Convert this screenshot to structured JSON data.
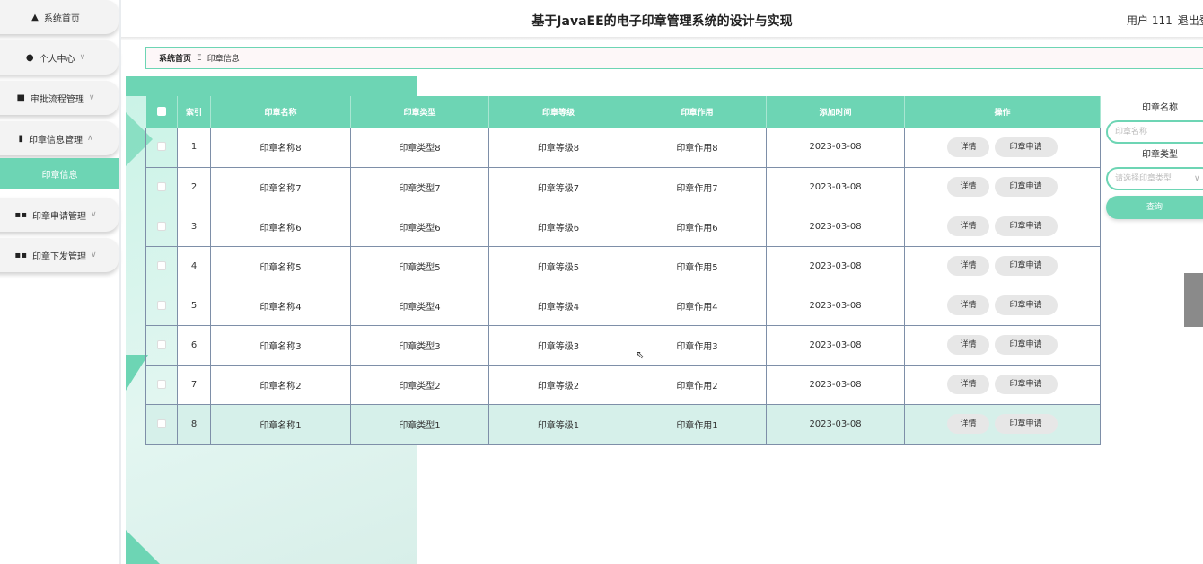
{
  "header": {
    "title": "基于JavaEE的电子印章管理系统的设计与实现",
    "user": "用户 111",
    "logout": "退出登"
  },
  "sidebar": {
    "items": [
      {
        "label": "系统首页",
        "icon": "home-icon",
        "chev": ""
      },
      {
        "label": "个人中心",
        "icon": "user-icon",
        "chev": "∨"
      },
      {
        "label": "审批流程管理",
        "icon": "briefcase-icon",
        "chev": "∨"
      },
      {
        "label": "印章信息管理",
        "icon": "clipboard-icon",
        "chev": "∧"
      },
      {
        "label": "印章申请管理",
        "icon": "grid-icon",
        "chev": "∨"
      },
      {
        "label": "印章下发管理",
        "icon": "grid-icon",
        "chev": "∨"
      }
    ],
    "active_sub": "印章信息"
  },
  "breadcrumb": {
    "home": "系统首页",
    "sep": "Ξ",
    "current": "印章信息"
  },
  "table": {
    "headers": [
      "索引",
      "印章名称",
      "印章类型",
      "印章等级",
      "印章作用",
      "添加时间",
      "操作"
    ],
    "rows": [
      {
        "index": "1",
        "name": "印章名称8",
        "type": "印章类型8",
        "level": "印章等级8",
        "use": "印章作用8",
        "date": "2023-03-08"
      },
      {
        "index": "2",
        "name": "印章名称7",
        "type": "印章类型7",
        "level": "印章等级7",
        "use": "印章作用7",
        "date": "2023-03-08"
      },
      {
        "index": "3",
        "name": "印章名称6",
        "type": "印章类型6",
        "level": "印章等级6",
        "use": "印章作用6",
        "date": "2023-03-08"
      },
      {
        "index": "4",
        "name": "印章名称5",
        "type": "印章类型5",
        "level": "印章等级5",
        "use": "印章作用5",
        "date": "2023-03-08"
      },
      {
        "index": "5",
        "name": "印章名称4",
        "type": "印章类型4",
        "level": "印章等级4",
        "use": "印章作用4",
        "date": "2023-03-08"
      },
      {
        "index": "6",
        "name": "印章名称3",
        "type": "印章类型3",
        "level": "印章等级3",
        "use": "印章作用3",
        "date": "2023-03-08"
      },
      {
        "index": "7",
        "name": "印章名称2",
        "type": "印章类型2",
        "level": "印章等级2",
        "use": "印章作用2",
        "date": "2023-03-08"
      },
      {
        "index": "8",
        "name": "印章名称1",
        "type": "印章类型1",
        "level": "印章等级1",
        "use": "印章作用1",
        "date": "2023-03-08"
      }
    ],
    "detail_label": "详情",
    "apply_label": "印章申请"
  },
  "search": {
    "name_label": "印章名称",
    "name_placeholder": "印章名称",
    "type_label": "印章类型",
    "type_placeholder": "请选择印章类型",
    "query_label": "查询"
  },
  "colors": {
    "accent": "#6dd5b4",
    "selected_row": "#d6f0ea"
  }
}
